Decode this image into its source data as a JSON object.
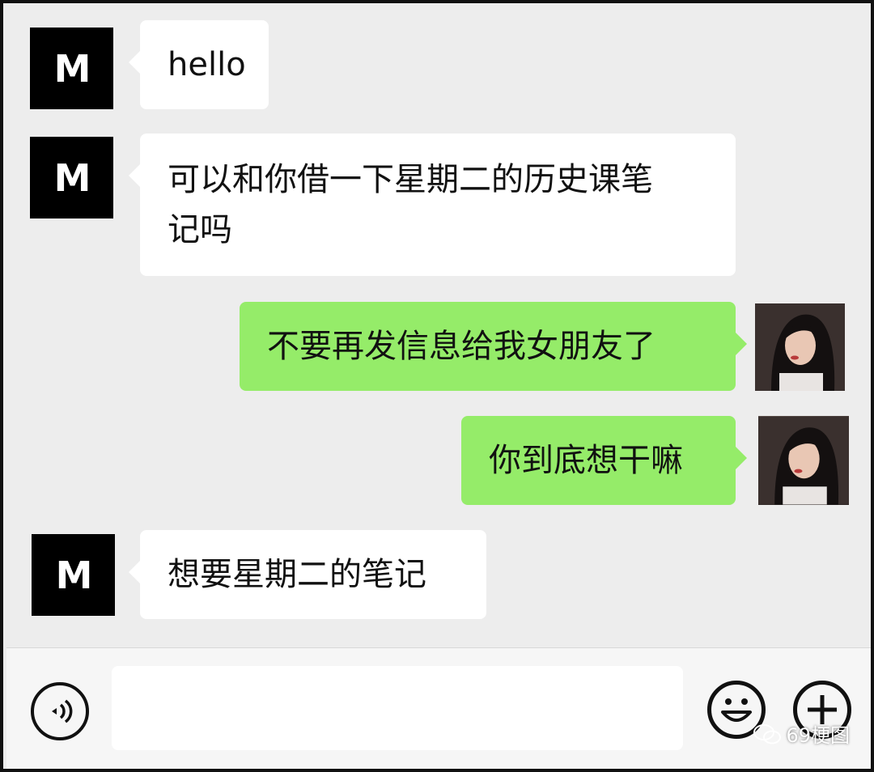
{
  "messages": [
    {
      "side": "in",
      "avatar": "m-logo-avatar",
      "text": "hello"
    },
    {
      "side": "in",
      "avatar": "m-logo-avatar",
      "line1": "可以和你借一下星期二的历史课笔",
      "line2": "记吗"
    },
    {
      "side": "out",
      "avatar": "girl-photo-avatar",
      "text": "不要再发信息给我女朋友了"
    },
    {
      "side": "out",
      "avatar": "girl-photo-avatar",
      "text": "你到底想干嘛"
    },
    {
      "side": "in",
      "avatar": "m-logo-avatar",
      "text": "想要星期二的笔记"
    }
  ],
  "avatar_logo_text": "M",
  "input": {
    "value": "",
    "placeholder": ""
  },
  "icons": {
    "voice": "voice-icon",
    "emoji": "emoji-icon",
    "plus": "plus-icon"
  },
  "watermark": {
    "text": "69梗图"
  },
  "colors": {
    "background": "#ededed",
    "incoming_bubble": "#ffffff",
    "outgoing_bubble": "#95ec69",
    "avatar_bg": "#000000"
  }
}
